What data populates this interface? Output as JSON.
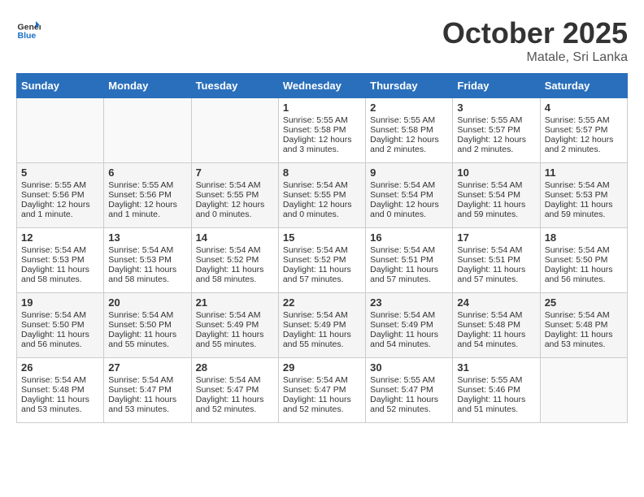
{
  "header": {
    "logo_line1": "General",
    "logo_line2": "Blue",
    "month": "October 2025",
    "location": "Matale, Sri Lanka"
  },
  "days_of_week": [
    "Sunday",
    "Monday",
    "Tuesday",
    "Wednesday",
    "Thursday",
    "Friday",
    "Saturday"
  ],
  "weeks": [
    [
      {
        "day": "",
        "info": ""
      },
      {
        "day": "",
        "info": ""
      },
      {
        "day": "",
        "info": ""
      },
      {
        "day": "1",
        "info": "Sunrise: 5:55 AM\nSunset: 5:58 PM\nDaylight: 12 hours\nand 3 minutes."
      },
      {
        "day": "2",
        "info": "Sunrise: 5:55 AM\nSunset: 5:58 PM\nDaylight: 12 hours\nand 2 minutes."
      },
      {
        "day": "3",
        "info": "Sunrise: 5:55 AM\nSunset: 5:57 PM\nDaylight: 12 hours\nand 2 minutes."
      },
      {
        "day": "4",
        "info": "Sunrise: 5:55 AM\nSunset: 5:57 PM\nDaylight: 12 hours\nand 2 minutes."
      }
    ],
    [
      {
        "day": "5",
        "info": "Sunrise: 5:55 AM\nSunset: 5:56 PM\nDaylight: 12 hours\nand 1 minute."
      },
      {
        "day": "6",
        "info": "Sunrise: 5:55 AM\nSunset: 5:56 PM\nDaylight: 12 hours\nand 1 minute."
      },
      {
        "day": "7",
        "info": "Sunrise: 5:54 AM\nSunset: 5:55 PM\nDaylight: 12 hours\nand 0 minutes."
      },
      {
        "day": "8",
        "info": "Sunrise: 5:54 AM\nSunset: 5:55 PM\nDaylight: 12 hours\nand 0 minutes."
      },
      {
        "day": "9",
        "info": "Sunrise: 5:54 AM\nSunset: 5:54 PM\nDaylight: 12 hours\nand 0 minutes."
      },
      {
        "day": "10",
        "info": "Sunrise: 5:54 AM\nSunset: 5:54 PM\nDaylight: 11 hours\nand 59 minutes."
      },
      {
        "day": "11",
        "info": "Sunrise: 5:54 AM\nSunset: 5:53 PM\nDaylight: 11 hours\nand 59 minutes."
      }
    ],
    [
      {
        "day": "12",
        "info": "Sunrise: 5:54 AM\nSunset: 5:53 PM\nDaylight: 11 hours\nand 58 minutes."
      },
      {
        "day": "13",
        "info": "Sunrise: 5:54 AM\nSunset: 5:53 PM\nDaylight: 11 hours\nand 58 minutes."
      },
      {
        "day": "14",
        "info": "Sunrise: 5:54 AM\nSunset: 5:52 PM\nDaylight: 11 hours\nand 58 minutes."
      },
      {
        "day": "15",
        "info": "Sunrise: 5:54 AM\nSunset: 5:52 PM\nDaylight: 11 hours\nand 57 minutes."
      },
      {
        "day": "16",
        "info": "Sunrise: 5:54 AM\nSunset: 5:51 PM\nDaylight: 11 hours\nand 57 minutes."
      },
      {
        "day": "17",
        "info": "Sunrise: 5:54 AM\nSunset: 5:51 PM\nDaylight: 11 hours\nand 57 minutes."
      },
      {
        "day": "18",
        "info": "Sunrise: 5:54 AM\nSunset: 5:50 PM\nDaylight: 11 hours\nand 56 minutes."
      }
    ],
    [
      {
        "day": "19",
        "info": "Sunrise: 5:54 AM\nSunset: 5:50 PM\nDaylight: 11 hours\nand 56 minutes."
      },
      {
        "day": "20",
        "info": "Sunrise: 5:54 AM\nSunset: 5:50 PM\nDaylight: 11 hours\nand 55 minutes."
      },
      {
        "day": "21",
        "info": "Sunrise: 5:54 AM\nSunset: 5:49 PM\nDaylight: 11 hours\nand 55 minutes."
      },
      {
        "day": "22",
        "info": "Sunrise: 5:54 AM\nSunset: 5:49 PM\nDaylight: 11 hours\nand 55 minutes."
      },
      {
        "day": "23",
        "info": "Sunrise: 5:54 AM\nSunset: 5:49 PM\nDaylight: 11 hours\nand 54 minutes."
      },
      {
        "day": "24",
        "info": "Sunrise: 5:54 AM\nSunset: 5:48 PM\nDaylight: 11 hours\nand 54 minutes."
      },
      {
        "day": "25",
        "info": "Sunrise: 5:54 AM\nSunset: 5:48 PM\nDaylight: 11 hours\nand 53 minutes."
      }
    ],
    [
      {
        "day": "26",
        "info": "Sunrise: 5:54 AM\nSunset: 5:48 PM\nDaylight: 11 hours\nand 53 minutes."
      },
      {
        "day": "27",
        "info": "Sunrise: 5:54 AM\nSunset: 5:47 PM\nDaylight: 11 hours\nand 53 minutes."
      },
      {
        "day": "28",
        "info": "Sunrise: 5:54 AM\nSunset: 5:47 PM\nDaylight: 11 hours\nand 52 minutes."
      },
      {
        "day": "29",
        "info": "Sunrise: 5:54 AM\nSunset: 5:47 PM\nDaylight: 11 hours\nand 52 minutes."
      },
      {
        "day": "30",
        "info": "Sunrise: 5:55 AM\nSunset: 5:47 PM\nDaylight: 11 hours\nand 52 minutes."
      },
      {
        "day": "31",
        "info": "Sunrise: 5:55 AM\nSunset: 5:46 PM\nDaylight: 11 hours\nand 51 minutes."
      },
      {
        "day": "",
        "info": ""
      }
    ]
  ]
}
